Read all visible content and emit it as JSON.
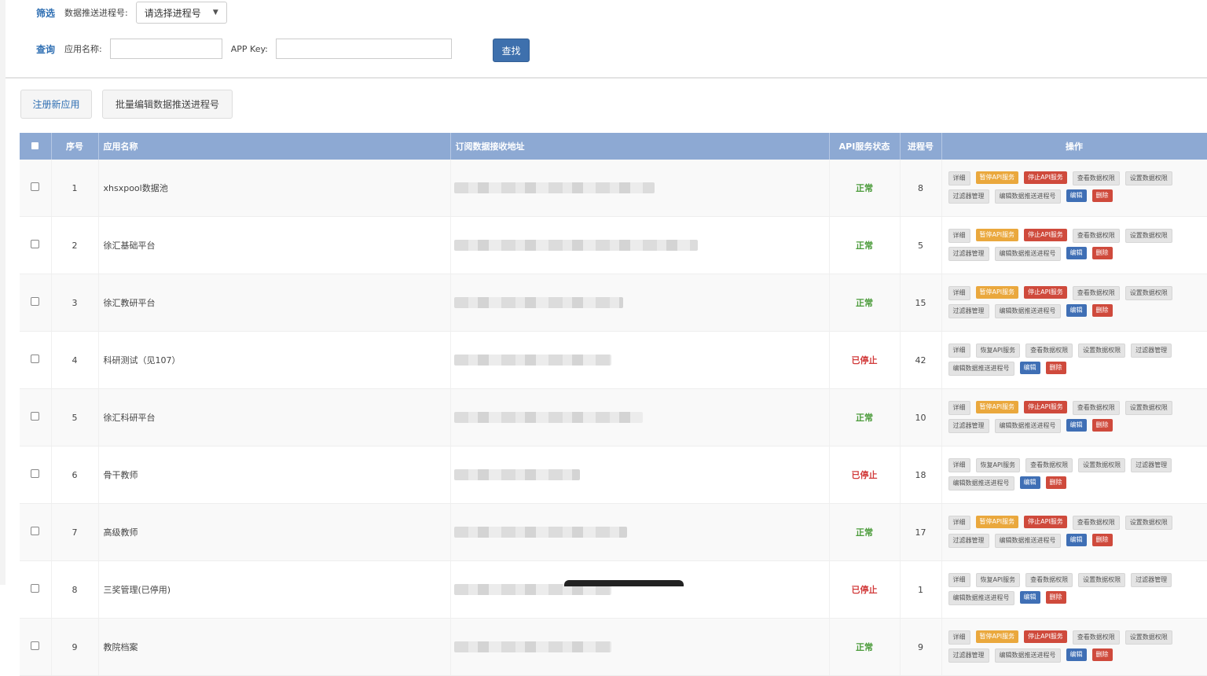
{
  "filter": {
    "label": "筛选",
    "process_label": "数据推送进程号:",
    "process_select": "请选择进程号"
  },
  "query": {
    "label": "查询",
    "app_name_label": "应用名称:",
    "app_name_value": "",
    "app_key_label": "APP Key:",
    "app_key_value": "",
    "search_button": "查找"
  },
  "actions": {
    "register": "注册新应用",
    "batch_edit": "批量编辑数据推送进程号"
  },
  "table": {
    "headers": {
      "index": "序号",
      "name": "应用名称",
      "url": "订阅数据接收地址",
      "status": "API服务状态",
      "process": "进程号",
      "ops": "操作"
    },
    "ops_running": [
      "详细",
      "暂停API服务",
      "停止API服务",
      "查看数据权限",
      "设置数据权限",
      "过滤器管理",
      "编辑数据推送进程号",
      "编辑",
      "删除"
    ],
    "ops_stopped": [
      "详细",
      "恢复API服务",
      "查看数据权限",
      "设置数据权限",
      "过滤器管理",
      "编辑数据推送进程号",
      "编辑",
      "删除"
    ],
    "rows": [
      {
        "index": "1",
        "name": "xhsxpool数据池",
        "status": "正常",
        "process": "8"
      },
      {
        "index": "2",
        "name": "徐汇基础平台",
        "status": "正常",
        "process": "5"
      },
      {
        "index": "3",
        "name": "徐汇教研平台",
        "status": "正常",
        "process": "15"
      },
      {
        "index": "4",
        "name": "科研测试（见107）",
        "status": "已停止",
        "process": "42"
      },
      {
        "index": "5",
        "name": "徐汇科研平台",
        "status": "正常",
        "process": "10"
      },
      {
        "index": "6",
        "name": "骨干教师",
        "status": "已停止",
        "process": "18"
      },
      {
        "index": "7",
        "name": "高级教师",
        "status": "正常",
        "process": "17"
      },
      {
        "index": "8",
        "name": "三奖管理(已停用)",
        "status": "已停止",
        "process": "1"
      },
      {
        "index": "9",
        "name": "教院档案",
        "status": "正常",
        "process": "9"
      }
    ]
  },
  "colors": {
    "header_bg": "#8da9d3",
    "primary": "#3f6fb5",
    "warning": "#eaa83d",
    "danger": "#cf4a3c",
    "ok": "#4b9b3a",
    "stopped": "#d23c3c"
  }
}
